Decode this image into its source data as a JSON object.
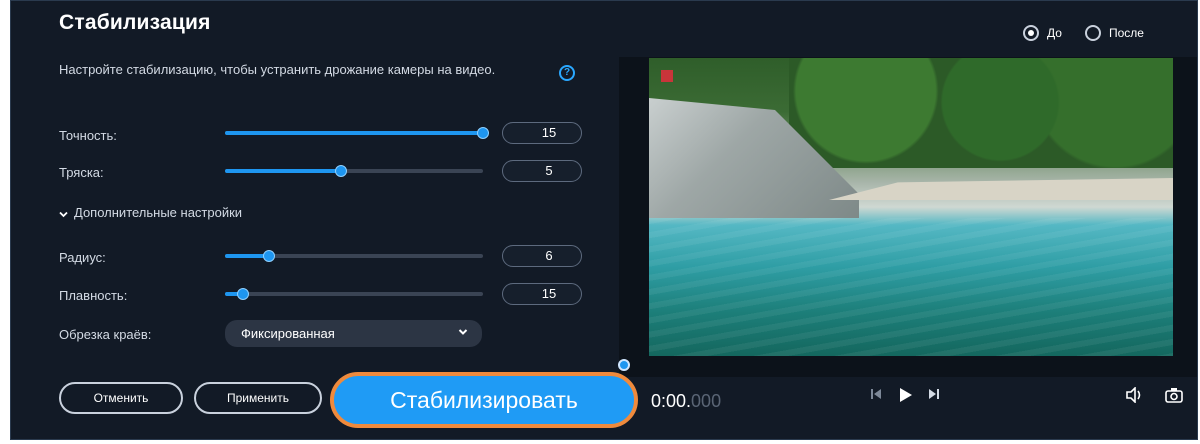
{
  "panel": {
    "title": "Стабилизация",
    "description": "Настройте стабилизацию, чтобы устранить дрожание камеры на видео.",
    "help_icon": "question-circle-icon",
    "sliders": [
      {
        "label": "Точность:",
        "value": "15",
        "level": 1.0
      },
      {
        "label": "Тряска:",
        "value": "5",
        "level": 0.45
      },
      {
        "label": "Радиус:",
        "value": "6",
        "level": 0.17
      },
      {
        "label": "Плавность:",
        "value": "15",
        "level": 0.07
      }
    ],
    "advanced_label": "Дополнительные настройки",
    "crop": {
      "label": "Обрезка краёв:",
      "value": "Фиксированная"
    },
    "buttons": {
      "cancel": "Отменить",
      "apply": "Применить",
      "stabilize": "Стабилизировать"
    }
  },
  "preview": {
    "compare": {
      "before": "До",
      "after": "После",
      "selected": "before"
    },
    "timecode": {
      "main": "0:00.",
      "ms": "000"
    }
  },
  "colors": {
    "accent": "#1e96f0",
    "highlight_border": "#ef8a3c",
    "background": "#121a26"
  }
}
